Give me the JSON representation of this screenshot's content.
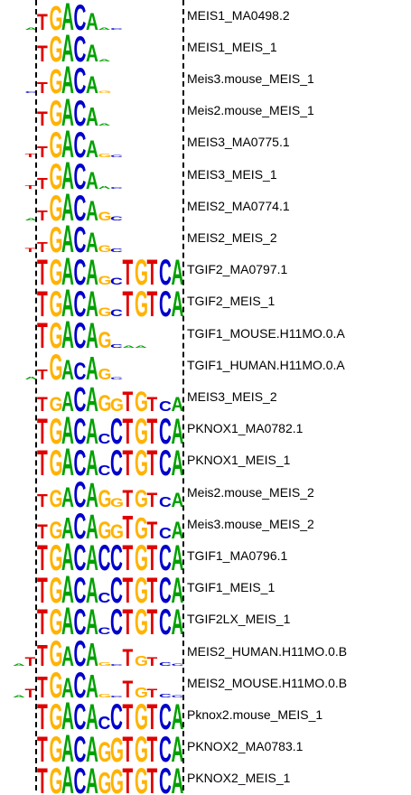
{
  "colors": {
    "A": "#00a000",
    "C": "#0000cc",
    "G": "#ffb300",
    "T": "#e00000",
    "guide": "#000000"
  },
  "alignment_guides": [
    "left-dashed-line",
    "right-dashed-line"
  ],
  "motifs": [
    {
      "name": "MEIS1_MA0498.2",
      "logo": [
        [
          "A",
          0.08
        ],
        [
          "T",
          0.55
        ],
        [
          "G",
          0.85
        ],
        [
          "A",
          0.95
        ],
        [
          "C",
          0.9
        ],
        [
          "A",
          0.6
        ],
        [
          "A",
          0.08
        ],
        [
          "C",
          0.05
        ]
      ]
    },
    {
      "name": "MEIS1_MEIS_1",
      "logo": [
        [
          "T",
          0.55
        ],
        [
          "G",
          0.9
        ],
        [
          "A",
          0.95
        ],
        [
          "C",
          0.9
        ],
        [
          "A",
          0.6
        ],
        [
          "A",
          0.08
        ]
      ]
    },
    {
      "name": "Meis3.mouse_MEIS_1",
      "logo": [
        [
          "C",
          0.05
        ],
        [
          "T",
          0.4
        ],
        [
          "G",
          0.85
        ],
        [
          "A",
          0.95
        ],
        [
          "C",
          0.9
        ],
        [
          "A",
          0.6
        ],
        [
          "G",
          0.08
        ]
      ]
    },
    {
      "name": "Meis2.mouse_MEIS_1",
      "logo": [
        [
          "T",
          0.5
        ],
        [
          "G",
          0.9
        ],
        [
          "A",
          0.95
        ],
        [
          "C",
          0.9
        ],
        [
          "A",
          0.65
        ],
        [
          "A",
          0.08
        ]
      ]
    },
    {
      "name": "MEIS3_MA0775.1",
      "logo": [
        [
          "T",
          0.12
        ],
        [
          "T",
          0.4
        ],
        [
          "G",
          0.9
        ],
        [
          "A",
          0.95
        ],
        [
          "C",
          0.9
        ],
        [
          "A",
          0.6
        ],
        [
          "G",
          0.12
        ],
        [
          "C",
          0.08
        ]
      ]
    },
    {
      "name": "MEIS3_MEIS_1",
      "logo": [
        [
          "T",
          0.12
        ],
        [
          "T",
          0.4
        ],
        [
          "G",
          0.9
        ],
        [
          "A",
          0.95
        ],
        [
          "C",
          0.9
        ],
        [
          "A",
          0.6
        ],
        [
          "A",
          0.1
        ],
        [
          "C",
          0.06
        ]
      ]
    },
    {
      "name": "MEIS2_MA0774.1",
      "logo": [
        [
          "A",
          0.08
        ],
        [
          "T",
          0.35
        ],
        [
          "G",
          0.9
        ],
        [
          "A",
          0.95
        ],
        [
          "C",
          0.9
        ],
        [
          "A",
          0.7
        ],
        [
          "G",
          0.3
        ],
        [
          "C",
          0.15
        ]
      ]
    },
    {
      "name": "MEIS2_MEIS_2",
      "logo": [
        [
          "T",
          0.15
        ],
        [
          "T",
          0.35
        ],
        [
          "G",
          0.9
        ],
        [
          "A",
          0.95
        ],
        [
          "C",
          0.9
        ],
        [
          "A",
          0.7
        ],
        [
          "G",
          0.25
        ],
        [
          "C",
          0.12
        ]
      ]
    },
    {
      "name": "TGIF2_MA0797.1",
      "logo": [
        [
          "T",
          0.9
        ],
        [
          "G",
          0.9
        ],
        [
          "A",
          0.95
        ],
        [
          "C",
          0.9
        ],
        [
          "A",
          0.9
        ],
        [
          "G",
          0.3
        ],
        [
          "C",
          0.25
        ],
        [
          "T",
          0.9
        ],
        [
          "G",
          0.9
        ],
        [
          "T",
          0.9
        ],
        [
          "C",
          0.9
        ],
        [
          "A",
          0.9
        ]
      ]
    },
    {
      "name": "TGIF2_MEIS_1",
      "logo": [
        [
          "T",
          0.9
        ],
        [
          "G",
          0.9
        ],
        [
          "A",
          0.95
        ],
        [
          "C",
          0.9
        ],
        [
          "A",
          0.9
        ],
        [
          "G",
          0.3
        ],
        [
          "C",
          0.25
        ],
        [
          "T",
          0.9
        ],
        [
          "G",
          0.9
        ],
        [
          "T",
          0.9
        ],
        [
          "C",
          0.9
        ],
        [
          "A",
          0.9
        ]
      ]
    },
    {
      "name": "TGIF1_MOUSE.H11MO.0.A",
      "logo": [
        [
          "T",
          0.9
        ],
        [
          "G",
          0.9
        ],
        [
          "A",
          0.95
        ],
        [
          "C",
          0.9
        ],
        [
          "A",
          0.9
        ],
        [
          "G",
          0.55
        ],
        [
          "C",
          0.12
        ],
        [
          "A",
          0.08
        ],
        [
          "A",
          0.08
        ]
      ]
    },
    {
      "name": "TGIF1_HUMAN.H11MO.0.A",
      "logo": [
        [
          "A",
          0.1
        ],
        [
          "T",
          0.35
        ],
        [
          "G",
          0.9
        ],
        [
          "A",
          0.7
        ],
        [
          "C",
          0.6
        ],
        [
          "A",
          0.8
        ],
        [
          "G",
          0.4
        ],
        [
          "C",
          0.08
        ]
      ]
    },
    {
      "name": "MEIS3_MEIS_2",
      "logo": [
        [
          "T",
          0.5
        ],
        [
          "G",
          0.5
        ],
        [
          "A",
          0.7
        ],
        [
          "C",
          0.85
        ],
        [
          "A",
          0.85
        ],
        [
          "G",
          0.55
        ],
        [
          "G",
          0.45
        ],
        [
          "T",
          0.7
        ],
        [
          "G",
          0.7
        ],
        [
          "T",
          0.5
        ],
        [
          "C",
          0.35
        ],
        [
          "A",
          0.5
        ]
      ]
    },
    {
      "name": "PKNOX1_MA0782.1",
      "logo": [
        [
          "T",
          0.9
        ],
        [
          "G",
          0.9
        ],
        [
          "A",
          0.95
        ],
        [
          "C",
          0.9
        ],
        [
          "A",
          0.9
        ],
        [
          "C",
          0.35
        ],
        [
          "C",
          0.9
        ],
        [
          "T",
          0.9
        ],
        [
          "G",
          0.9
        ],
        [
          "T",
          0.9
        ],
        [
          "C",
          0.9
        ],
        [
          "A",
          0.9
        ]
      ]
    },
    {
      "name": "PKNOX1_MEIS_1",
      "logo": [
        [
          "T",
          0.9
        ],
        [
          "G",
          0.9
        ],
        [
          "A",
          0.95
        ],
        [
          "C",
          0.9
        ],
        [
          "A",
          0.9
        ],
        [
          "C",
          0.35
        ],
        [
          "C",
          0.9
        ],
        [
          "T",
          0.9
        ],
        [
          "G",
          0.9
        ],
        [
          "T",
          0.9
        ],
        [
          "C",
          0.9
        ],
        [
          "A",
          0.9
        ]
      ]
    },
    {
      "name": "Meis2.mouse_MEIS_2",
      "logo": [
        [
          "T",
          0.45
        ],
        [
          "G",
          0.6
        ],
        [
          "A",
          0.7
        ],
        [
          "C",
          0.9
        ],
        [
          "A",
          0.85
        ],
        [
          "G",
          0.6
        ],
        [
          "G",
          0.3
        ],
        [
          "T",
          0.6
        ],
        [
          "G",
          0.6
        ],
        [
          "T",
          0.5
        ],
        [
          "C",
          0.35
        ],
        [
          "A",
          0.5
        ]
      ]
    },
    {
      "name": "Meis3.mouse_MEIS_2",
      "logo": [
        [
          "T",
          0.5
        ],
        [
          "G",
          0.6
        ],
        [
          "A",
          0.75
        ],
        [
          "C",
          0.9
        ],
        [
          "A",
          0.85
        ],
        [
          "G",
          0.6
        ],
        [
          "G",
          0.5
        ],
        [
          "T",
          0.8
        ],
        [
          "G",
          0.75
        ],
        [
          "T",
          0.6
        ],
        [
          "C",
          0.4
        ],
        [
          "A",
          0.6
        ]
      ]
    },
    {
      "name": "TGIF1_MA0796.1",
      "logo": [
        [
          "T",
          0.9
        ],
        [
          "G",
          0.9
        ],
        [
          "A",
          0.95
        ],
        [
          "C",
          0.9
        ],
        [
          "A",
          0.9
        ],
        [
          "C",
          0.9
        ],
        [
          "C",
          0.9
        ],
        [
          "T",
          0.9
        ],
        [
          "G",
          0.9
        ],
        [
          "T",
          0.9
        ],
        [
          "C",
          0.9
        ],
        [
          "A",
          0.9
        ]
      ]
    },
    {
      "name": "TGIF1_MEIS_1",
      "logo": [
        [
          "T",
          0.9
        ],
        [
          "G",
          0.9
        ],
        [
          "A",
          0.95
        ],
        [
          "C",
          0.9
        ],
        [
          "A",
          0.9
        ],
        [
          "C",
          0.35
        ],
        [
          "C",
          0.9
        ],
        [
          "T",
          0.9
        ],
        [
          "G",
          0.9
        ],
        [
          "T",
          0.9
        ],
        [
          "C",
          0.9
        ],
        [
          "A",
          0.9
        ]
      ]
    },
    {
      "name": "TGIF2LX_MEIS_1",
      "logo": [
        [
          "T",
          0.9
        ],
        [
          "G",
          0.9
        ],
        [
          "A",
          0.95
        ],
        [
          "C",
          0.9
        ],
        [
          "A",
          0.9
        ],
        [
          "C",
          0.25
        ],
        [
          "C",
          0.9
        ],
        [
          "T",
          0.9
        ],
        [
          "G",
          0.9
        ],
        [
          "T",
          0.9
        ],
        [
          "C",
          0.9
        ],
        [
          "A",
          0.9
        ]
      ]
    },
    {
      "name": "MEIS2_HUMAN.H11MO.0.B",
      "logo": [
        [
          "A",
          0.08
        ],
        [
          "T",
          0.3
        ],
        [
          "T",
          0.75
        ],
        [
          "G",
          0.9
        ],
        [
          "A",
          0.7
        ],
        [
          "C",
          0.9
        ],
        [
          "A",
          0.8
        ],
        [
          "G",
          0.12
        ],
        [
          "C",
          0.05
        ],
        [
          "T",
          0.6
        ],
        [
          "G",
          0.35
        ],
        [
          "T",
          0.3
        ],
        [
          "C",
          0.12
        ],
        [
          "C",
          0.08
        ]
      ]
    },
    {
      "name": "MEIS2_MOUSE.H11MO.0.B",
      "logo": [
        [
          "A",
          0.08
        ],
        [
          "T",
          0.3
        ],
        [
          "T",
          0.75
        ],
        [
          "G",
          0.9
        ],
        [
          "A",
          0.7
        ],
        [
          "C",
          0.9
        ],
        [
          "A",
          0.8
        ],
        [
          "G",
          0.12
        ],
        [
          "C",
          0.05
        ],
        [
          "T",
          0.6
        ],
        [
          "G",
          0.35
        ],
        [
          "T",
          0.3
        ],
        [
          "C",
          0.12
        ],
        [
          "C",
          0.08
        ]
      ]
    },
    {
      "name": "Pknox2.mouse_MEIS_1",
      "logo": [
        [
          "T",
          0.9
        ],
        [
          "G",
          0.9
        ],
        [
          "A",
          0.95
        ],
        [
          "C",
          0.9
        ],
        [
          "A",
          0.9
        ],
        [
          "C",
          0.45
        ],
        [
          "C",
          0.9
        ],
        [
          "T",
          0.9
        ],
        [
          "G",
          0.9
        ],
        [
          "T",
          0.9
        ],
        [
          "C",
          0.9
        ],
        [
          "A",
          0.9
        ]
      ]
    },
    {
      "name": "PKNOX2_MA0783.1",
      "logo": [
        [
          "T",
          0.9
        ],
        [
          "G",
          0.9
        ],
        [
          "A",
          0.95
        ],
        [
          "C",
          0.9
        ],
        [
          "A",
          0.9
        ],
        [
          "G",
          0.7
        ],
        [
          "G",
          0.85
        ],
        [
          "T",
          0.9
        ],
        [
          "G",
          0.9
        ],
        [
          "T",
          0.9
        ],
        [
          "C",
          0.9
        ],
        [
          "A",
          0.9
        ]
      ]
    },
    {
      "name": "PKNOX2_MEIS_1",
      "logo": [
        [
          "T",
          0.9
        ],
        [
          "G",
          0.9
        ],
        [
          "A",
          0.95
        ],
        [
          "C",
          0.9
        ],
        [
          "A",
          0.9
        ],
        [
          "G",
          0.75
        ],
        [
          "G",
          0.85
        ],
        [
          "T",
          0.9
        ],
        [
          "G",
          0.9
        ],
        [
          "T",
          0.9
        ],
        [
          "C",
          0.9
        ],
        [
          "A",
          0.9
        ]
      ]
    }
  ]
}
